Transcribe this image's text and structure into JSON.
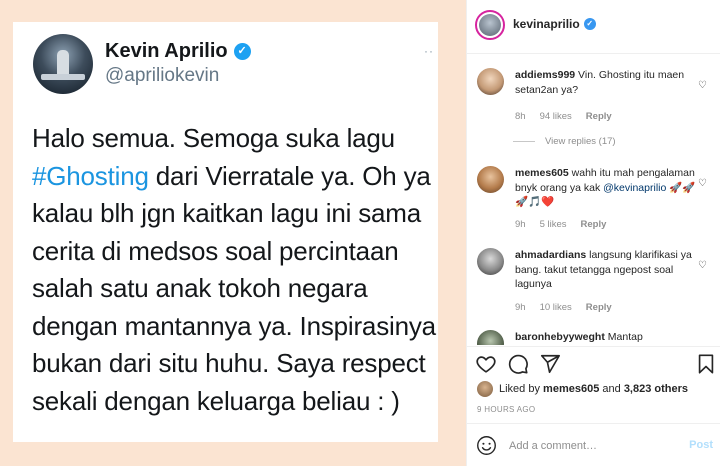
{
  "tweet": {
    "name": "Kevin Aprilio",
    "handle": "@apriliokevin",
    "more": "··",
    "lines": [
      "Halo semua. Semoga suka lagu",
      "dari Vierratale ya. Oh ya",
      "kalau blh jgn kaitkan lagu ini sama",
      "cerita di medsos soal percintaan",
      "salah satu anak tokoh negara",
      "dengan mantannya ya. Inspirasinya",
      "bukan dari situ huhu. Saya respect",
      "sekali dengan keluarga beliau : )"
    ],
    "hashtag": "#Ghosting"
  },
  "header": {
    "username": "kevinaprilio"
  },
  "comments": [
    {
      "user": "addiems999",
      "text": "Vin. Ghosting itu maen setan2an ya?",
      "time": "8h",
      "likes": "94 likes",
      "reply": "Reply",
      "view_replies": "View replies (17)"
    },
    {
      "user": "memes605",
      "text": "wahh itu mah pengalaman bnyk orang ya kak",
      "mention": "@kevinaprilio",
      "emoji": "🚀🚀🚀🎵❤️",
      "time": "9h",
      "likes": "5 likes",
      "reply": "Reply"
    },
    {
      "user": "ahmadardians",
      "text": "langsung klarifikasi ya bang. takut tetangga ngepost soal lagunya",
      "time": "9h",
      "likes": "10 likes",
      "reply": "Reply"
    },
    {
      "user": "baronhebyyweght",
      "text": "Mantap"
    }
  ],
  "likes": {
    "prefix": "Liked by",
    "user": "memes605",
    "and": "and",
    "count": "3,823 others"
  },
  "time_ago": "9 HOURS AGO",
  "add_comment": {
    "placeholder": "Add a comment…",
    "post": "Post"
  }
}
